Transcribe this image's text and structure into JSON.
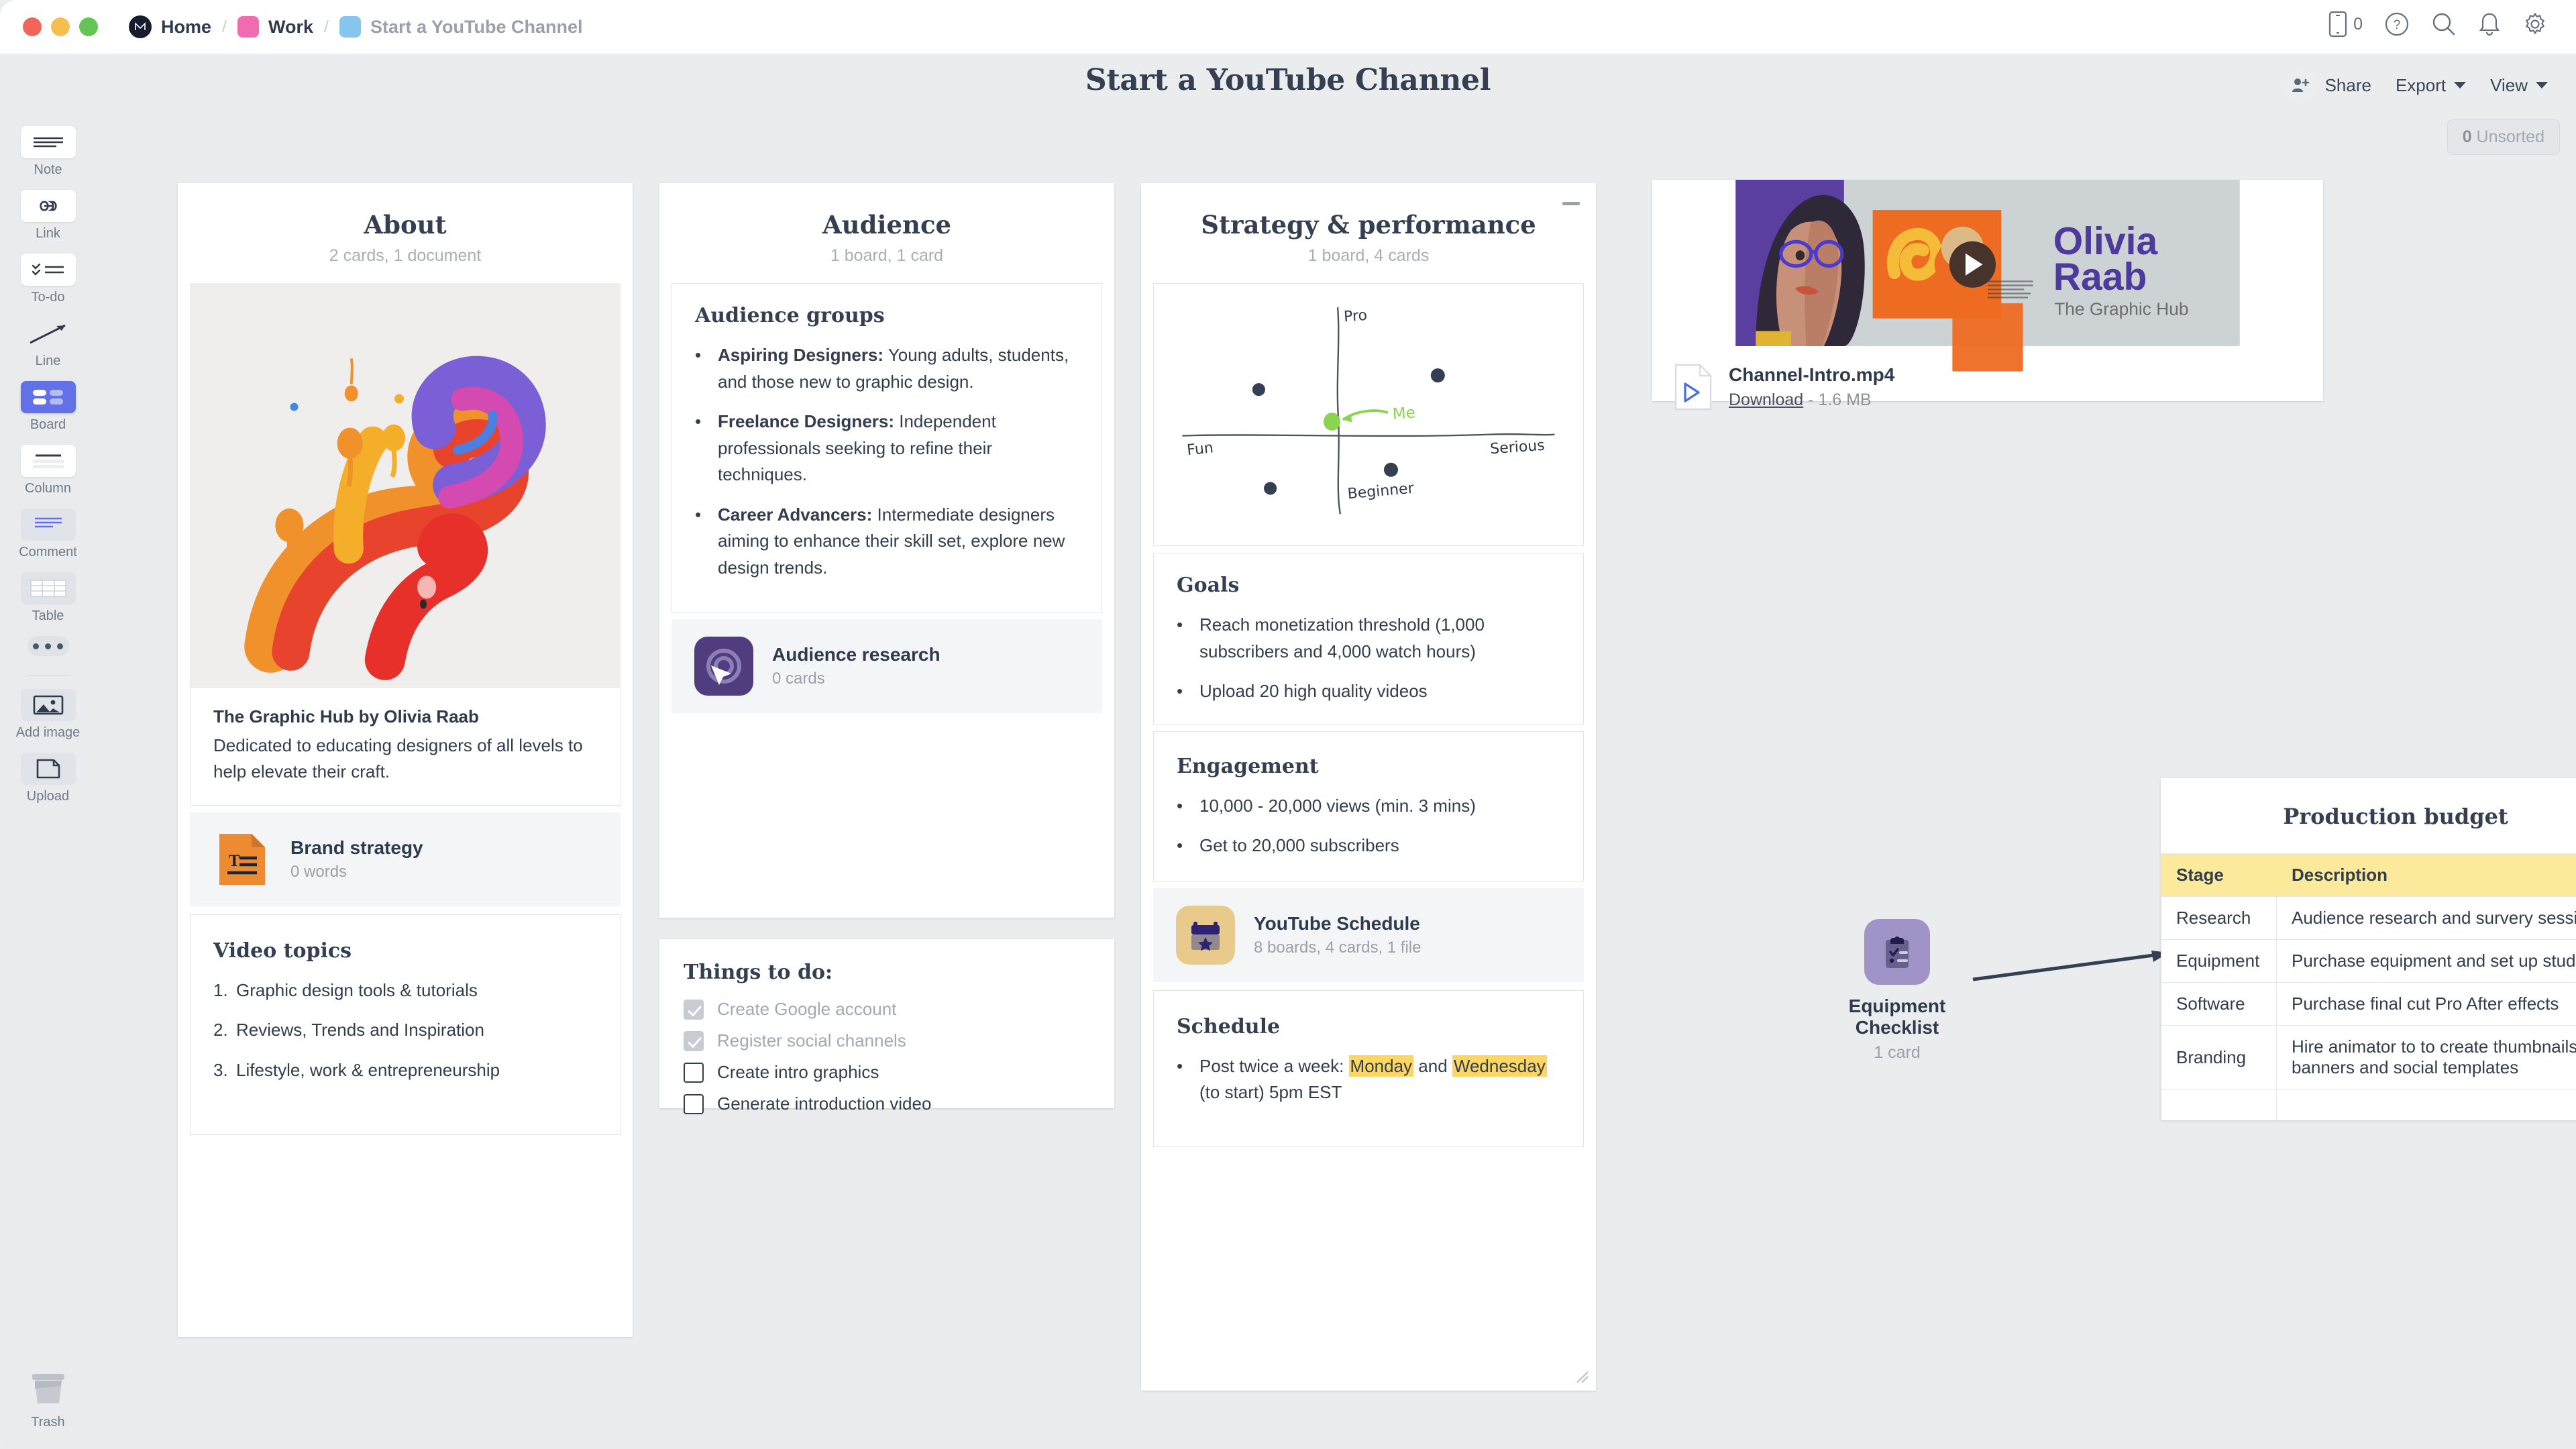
{
  "window": {
    "breadcrumb": [
      {
        "label": "Home",
        "icon": "milanote-logo-icon"
      },
      {
        "label": "Work",
        "icon": "pink-square-icon"
      },
      {
        "label": "Start a YouTube Channel",
        "icon": "blue-square-icon"
      }
    ]
  },
  "header": {
    "title": "Start a YouTube Channel",
    "mobile_count": "0",
    "icons": [
      "mobile-icon",
      "help-icon",
      "search-icon",
      "notifications-icon",
      "settings-icon"
    ],
    "actions": {
      "share": "Share",
      "export": "Export",
      "view": "View"
    }
  },
  "canvas": {
    "unsorted_count": "0",
    "unsorted_label": "Unsorted"
  },
  "toolbar": {
    "items": [
      {
        "label": "Note",
        "icon": "note-icon"
      },
      {
        "label": "Link",
        "icon": "link-icon"
      },
      {
        "label": "To-do",
        "icon": "todo-icon"
      },
      {
        "label": "Line",
        "icon": "line-arrow-icon"
      },
      {
        "label": "Board",
        "icon": "board-icon"
      },
      {
        "label": "Column",
        "icon": "column-icon"
      },
      {
        "label": "Comment",
        "icon": "comment-icon"
      },
      {
        "label": "Table",
        "icon": "table-icon"
      }
    ],
    "more": "more-options-icon",
    "extras": [
      {
        "label": "Add image",
        "icon": "add-image-icon"
      },
      {
        "label": "Upload",
        "icon": "upload-icon"
      }
    ],
    "trash": {
      "label": "Trash",
      "icon": "trash-icon"
    }
  },
  "columns": {
    "about": {
      "title": "About",
      "subtitle": "2 cards, 1 document",
      "image_alt": "paint-splash-image",
      "note": {
        "title": "The Graphic Hub by Olivia Raab",
        "body": "Dedicated to educating designers of all levels to help elevate their craft."
      },
      "document": {
        "name": "Brand strategy",
        "meta": "0 words",
        "icon": "text-document-icon",
        "color": "#ed8b33"
      },
      "video_topics": {
        "heading": "Video topics",
        "items": [
          "Graphic design tools & tutorials",
          "Reviews, Trends and Inspiration",
          "Lifestyle, work & entrepreneurship"
        ]
      }
    },
    "audience": {
      "title": "Audience",
      "subtitle": "1 board, 1 card",
      "groups": {
        "heading": "Audience groups",
        "items": [
          {
            "term": "Aspiring Designers:",
            "desc": " Young adults, students, and those new to graphic design."
          },
          {
            "term": "Freelance Designers:",
            "desc": " Independent professionals seeking to refine their techniques."
          },
          {
            "term": "Career Advancers:",
            "desc": " Intermediate designers aiming to enhance their skill set, explore new design trends."
          }
        ]
      },
      "board": {
        "name": "Audience research",
        "meta": "0 cards",
        "icon": "target-cursor-icon",
        "color": "#4f3d7f"
      },
      "todo": {
        "heading": "Things to do:",
        "items": [
          {
            "label": "Create Google account",
            "checked": true
          },
          {
            "label": "Register social channels",
            "checked": true
          },
          {
            "label": "Create intro graphics",
            "checked": false
          },
          {
            "label": "Generate introduction video",
            "checked": false
          }
        ]
      }
    },
    "strategy": {
      "title": "Strategy & performance",
      "subtitle": "1 board, 4 cards",
      "sketch": {
        "type": "quadrant-sketch",
        "axis_top": "Pro",
        "axis_bottom": "Beginner",
        "axis_left": "Fun",
        "axis_right": "Serious",
        "annotation": "Me",
        "points": [
          {
            "x": 0.27,
            "y": 0.38,
            "color": "#343f52"
          },
          {
            "x": 0.82,
            "y": 0.3,
            "color": "#343f52"
          },
          {
            "x": 0.64,
            "y": 0.72,
            "color": "#343f52"
          },
          {
            "x": 0.3,
            "y": 0.82,
            "color": "#343f52"
          },
          {
            "x": 0.505,
            "y": 0.545,
            "color": "#87cf52"
          }
        ]
      },
      "goals": {
        "heading": "Goals",
        "items": [
          "Reach monetization threshold (1,000 subscribers and 4,000 watch hours)",
          "Upload 20 high quality videos"
        ]
      },
      "engagement": {
        "heading": "Engagement",
        "items": [
          "10,000 - 20,000 views (min. 3 mins)",
          "Get to 20,000 subscribers"
        ]
      },
      "board": {
        "name": "YouTube Schedule",
        "meta": "8 boards, 4 cards, 1 file",
        "icon": "calendar-star-icon",
        "color": "#e8cb8c"
      },
      "schedule": {
        "heading": "Schedule",
        "text_before": "Post twice a week: ",
        "hl1": "Monday",
        "text_mid": " and ",
        "hl2": "Wednesday",
        "text_after": " (to start) 5pm EST"
      }
    }
  },
  "media": {
    "title_line1": "Olivia",
    "title_line2": "Raab",
    "subtitle": "The Graphic Hub",
    "play_icon": "play-button-icon",
    "file": {
      "name": "Channel-Intro.mp4",
      "download_label": "Download",
      "size": "- 1.6 MB",
      "icon": "video-file-icon"
    }
  },
  "equipment_board": {
    "name": "Equipment Checklist",
    "meta": "1 card",
    "icon": "clipboard-checklist-icon",
    "color": "#9f93c7"
  },
  "budget_table": {
    "title": "Production budget",
    "columns": [
      "Stage",
      "Description"
    ],
    "rows": [
      [
        "Research",
        "Audience research and survery sessions"
      ],
      [
        "Equipment",
        "Purchase equipment and set up studio"
      ],
      [
        "Software",
        "Purchase final cut Pro After effects"
      ],
      [
        "Branding",
        "Hire animator to to create thumbnails banners and social templates"
      ]
    ]
  },
  "colors": {
    "accent_blue": "#6271e8",
    "highlight_yellow": "#fcd663",
    "table_header": "#fbe99c",
    "text_dark": "#333d4d",
    "text_muted": "#9ba0a9"
  }
}
